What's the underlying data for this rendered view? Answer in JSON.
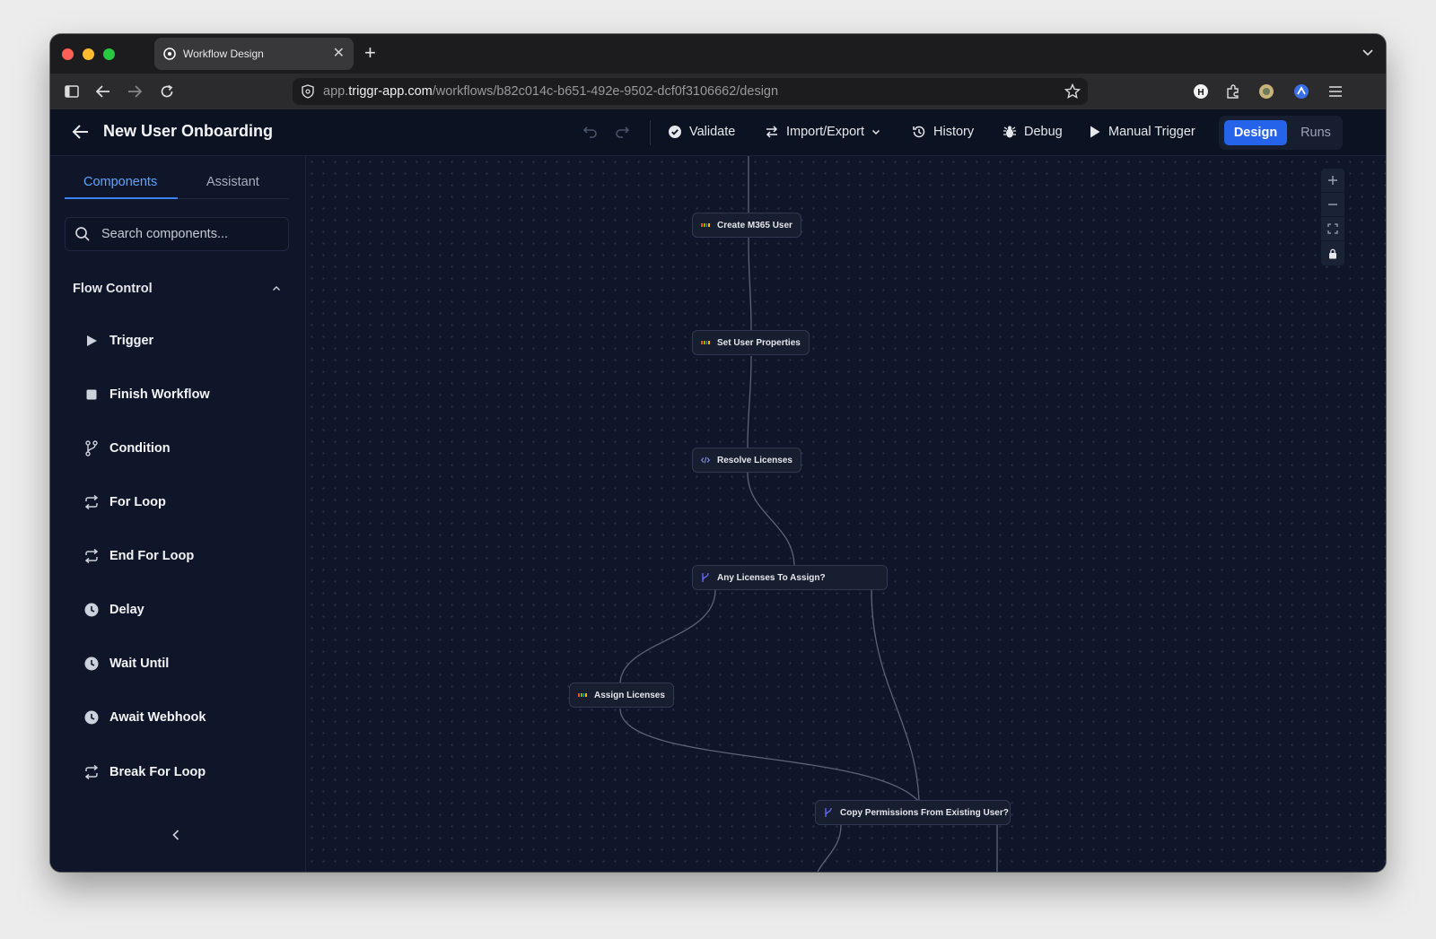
{
  "browser": {
    "tab_title": "Workflow Design",
    "url_prefix": "app.",
    "url_host": "triggr-app.com",
    "url_path": "/workflows/b82c014c-b651-492e-9502-dcf0f3106662/design"
  },
  "header": {
    "title": "New User Onboarding",
    "validate": "Validate",
    "import_export": "Import/Export",
    "history": "History",
    "debug": "Debug",
    "manual_trigger": "Manual Trigger",
    "design": "Design",
    "runs": "Runs"
  },
  "sidebar": {
    "tabs": [
      "Components",
      "Assistant"
    ],
    "active_tab": "Components",
    "search_placeholder": "Search components...",
    "section": "Flow Control",
    "items": [
      {
        "label": "Trigger",
        "icon": "play-icon"
      },
      {
        "label": "Finish Workflow",
        "icon": "stop-icon"
      },
      {
        "label": "Condition",
        "icon": "branch-icon"
      },
      {
        "label": "For Loop",
        "icon": "loop-icon"
      },
      {
        "label": "End For Loop",
        "icon": "loop-icon"
      },
      {
        "label": "Delay",
        "icon": "clock-icon"
      },
      {
        "label": "Wait Until",
        "icon": "clock-icon"
      },
      {
        "label": "Await Webhook",
        "icon": "clock-icon"
      },
      {
        "label": "Break For Loop",
        "icon": "loop-icon"
      }
    ]
  },
  "canvas": {
    "nodes": [
      {
        "label": "Create M365 User",
        "icon": "microsoft-icon"
      },
      {
        "label": "Set User Properties",
        "icon": "microsoft-icon"
      },
      {
        "label": "Resolve Licenses",
        "icon": "code-icon"
      },
      {
        "label": "Any Licenses To Assign?",
        "icon": "condition-icon"
      },
      {
        "label": "Assign Licenses",
        "icon": "microsoft-icon"
      },
      {
        "label": "Copy Permissions From Existing User?",
        "icon": "condition-icon"
      }
    ],
    "zoom_controls": [
      "zoom-in-icon",
      "zoom-out-icon",
      "fit-view-icon",
      "lock-icon"
    ]
  },
  "colors": {
    "accent": "#2563eb",
    "canvas_bg": "#0f1629",
    "node_bg": "#161e30",
    "active_tab": "#60a5fa"
  }
}
